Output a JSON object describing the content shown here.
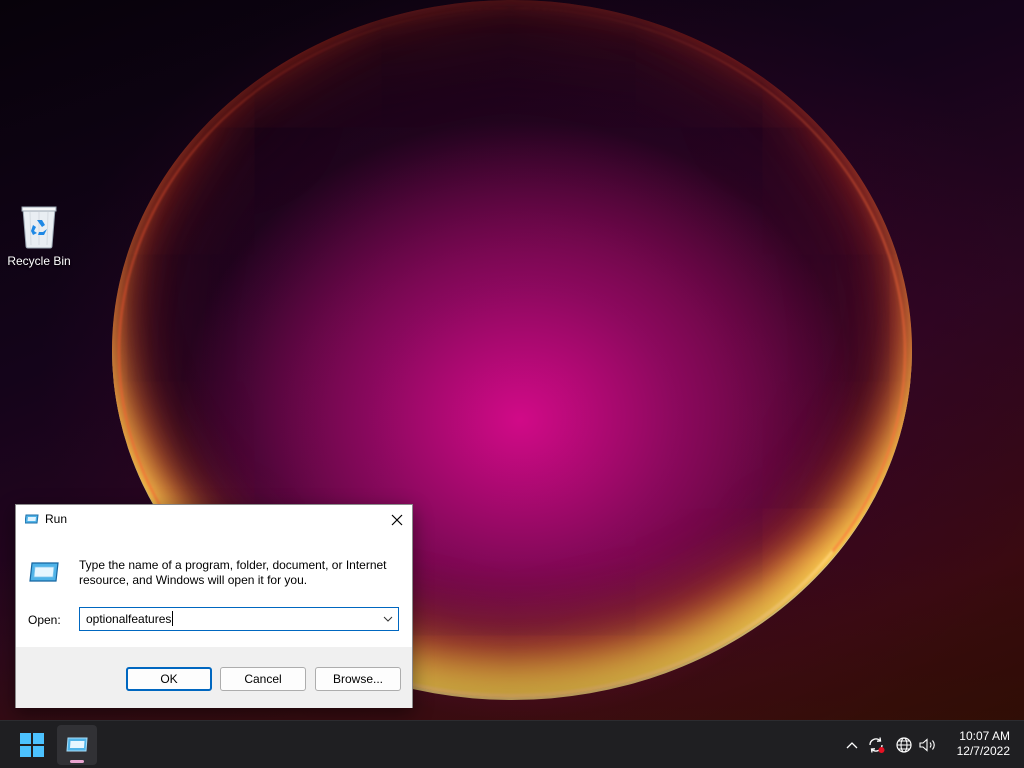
{
  "desktop": {
    "icons": [
      {
        "label": "Recycle Bin",
        "icon": "recycle-bin-icon"
      }
    ]
  },
  "run_dialog": {
    "title": "Run",
    "description": "Type the name of a program, folder, document, or Internet resource, and Windows will open it for you.",
    "open_label": "Open:",
    "open_value": "optionalfeatures",
    "buttons": {
      "ok": "OK",
      "cancel": "Cancel",
      "browse": "Browse..."
    }
  },
  "taskbar": {
    "clock": {
      "time": "10:07 AM",
      "date": "12/7/2022"
    },
    "tray_icons": [
      "chevron-up-icon",
      "sync-icon",
      "network-globe-icon",
      "volume-icon"
    ]
  },
  "colors": {
    "accent": "#0067c0",
    "taskbar": "#1f1f22",
    "windows_blue": "#4cc2ff"
  }
}
